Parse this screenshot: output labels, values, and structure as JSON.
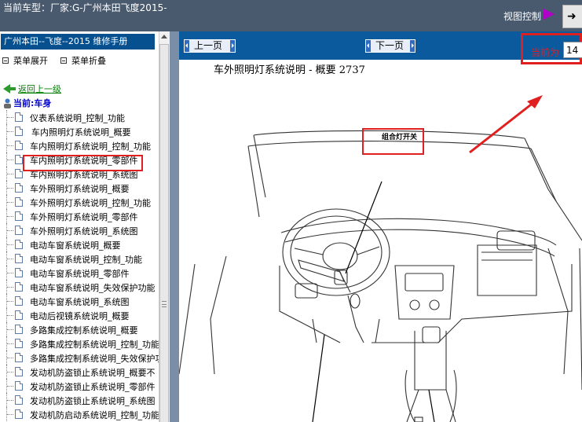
{
  "header": {
    "current_model": "当前车型：厂家:G-广州本田飞度2015-",
    "view_control": "视图控制",
    "corner_button": "➜"
  },
  "sidebar": {
    "manual_title": "广州本田--飞度--2015 维修手册",
    "expand_all": "菜单展开",
    "collapse_all": "菜单折叠",
    "back_up": "返回上一级",
    "current_node": "当前:车身",
    "items": [
      {
        "label": "仪表系统说明_控制_功能"
      },
      {
        "label": "车内照明灯系统说明_概要"
      },
      {
        "label": "车内照明灯系统说明_控制_功能"
      },
      {
        "label": "车内照明灯系统说明_零部件"
      },
      {
        "label": "车内照明灯系统说明_系统图"
      },
      {
        "label": "车外照明灯系统说明_概要"
      },
      {
        "label": "车外照明灯系统说明_控制_功能"
      },
      {
        "label": "车外照明灯系统说明_零部件"
      },
      {
        "label": "车外照明灯系统说明_系统图"
      },
      {
        "label": "电动车窗系统说明_概要"
      },
      {
        "label": "电动车窗系统说明_控制_功能"
      },
      {
        "label": "电动车窗系统说明_零部件"
      },
      {
        "label": "电动车窗系统说明_失效保护功能"
      },
      {
        "label": "电动车窗系统说明_系统图"
      },
      {
        "label": "电动后视镜系统说明_概要"
      },
      {
        "label": "多路集成控制系统说明_概要"
      },
      {
        "label": "多路集成控制系统说明_控制_功能"
      },
      {
        "label": "多路集成控制系统说明_失效保护功能"
      },
      {
        "label": "发动机防盗锁止系统说明_概要不"
      },
      {
        "label": "发动机防盗锁止系统说明_零部件"
      },
      {
        "label": "发动机防盗锁止系统说明_系统图"
      },
      {
        "label": "发动机防启动系统说明_控制_功能"
      }
    ],
    "selected_index": 1
  },
  "viewer": {
    "prev_page": "上一页",
    "next_page": "下一页",
    "current_page_label": "当前为",
    "current_page_value": "14",
    "page_heading": "车外照明灯系统说明 - 概要 2737",
    "callout_label": "组合灯开关"
  },
  "colors": {
    "top_bar": "#4a5a6e",
    "manual_title_bg": "#06508f",
    "viewer_toolbar": "#0c5a9e",
    "highlight": "#e02020",
    "link_green": "#008000"
  }
}
